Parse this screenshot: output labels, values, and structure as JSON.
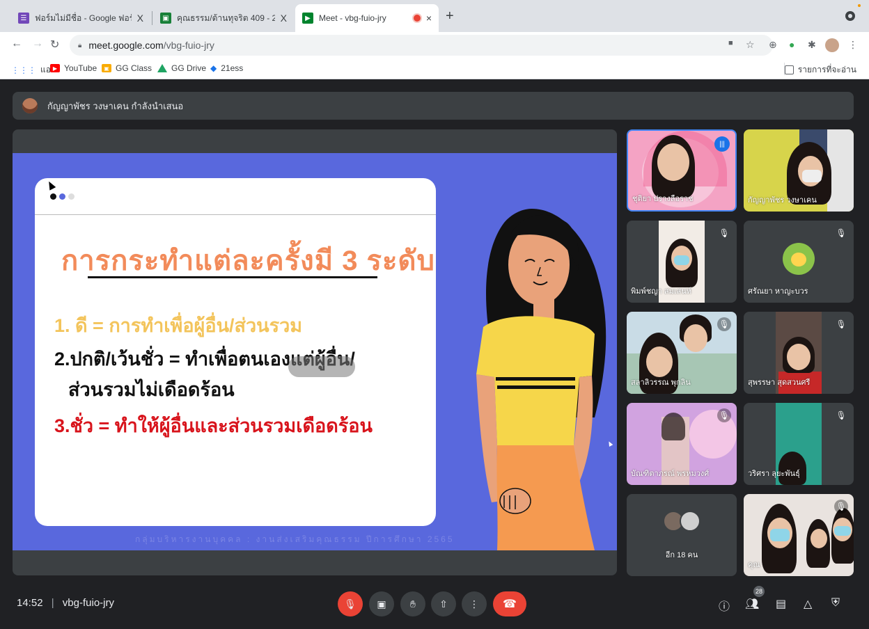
{
  "browser": {
    "tabs": [
      {
        "title": "ฟอร์มไม่มีชื่อ - Google ฟอร์ม",
        "close": "X",
        "favicon_color": "#7248b9"
      },
      {
        "title": "คุณธรรม/ต้านทุจริต 409 - 2564 ม",
        "close": "X",
        "favicon_color": "#188038"
      },
      {
        "title": "Meet - vbg-fuio-jry",
        "close": "×",
        "favicon_color": "#00832d",
        "recording_color": "#ea4335"
      }
    ],
    "new_tab": "+",
    "url_host": "meet.google.com",
    "url_path": "/vbg-fuio-jry",
    "bookmarks": [
      {
        "label": "แอป",
        "color": "#4285f4"
      },
      {
        "label": "YouTube",
        "color": "#ff0000"
      },
      {
        "label": "GG Class",
        "color": "#f9ab00"
      },
      {
        "label": "GG Drive",
        "color": "#1fa463"
      },
      {
        "label": "21ess",
        "color": "#1a73e8"
      }
    ],
    "reading_list": "รายการที่จะอ่าน"
  },
  "meet": {
    "presenting_text": "กัญญาพัชร วงษาเคน กำลังนำเสนอ",
    "slide": {
      "title": "การกระทำแต่ละครั้งมี 3 ระดับ",
      "line1": "1. ดี = การทำเพื่อผู้อื่น/ส่วนรวม",
      "line2": "2.ปกติ/เว้นชั่ว = ทำเพื่อตนเองแต่ผู้อื่น/",
      "line3": "ส่วนรวมไม่เดือดร้อน",
      "line4": "3.ชั่ว = ทำให้ผู้อื่นและส่วนรวมเดือดร้อน",
      "footer": "กลุ่มบริหารงานบุคคล : งานส่งเสริมคุณธรรม ปีการศึกษา 2565"
    },
    "participants": [
      {
        "name": "ชุติยา ปรางลือราช",
        "status": "speaking"
      },
      {
        "name": "กัญญาพัชร วงษาเคน",
        "status": "none"
      },
      {
        "name": "พิมพ์ชญา สมเสน่ห์",
        "status": "muted"
      },
      {
        "name": "ศรัณยา หาญะบวร",
        "status": "muted"
      },
      {
        "name": "สลาลิวรรณ พุกลิน",
        "status": "muted"
      },
      {
        "name": "สุพรรษา สุดสวนศรี",
        "status": "muted"
      },
      {
        "name": "บัณฑิตาภรณ์ พรหมวงศ์",
        "status": "muted"
      },
      {
        "name": "วริศรา ลุยะพันธุ์",
        "status": "muted"
      },
      {
        "name": "อีก 18 คน",
        "status": "none"
      },
      {
        "name": "คุณ",
        "status": "muted"
      }
    ],
    "time": "14:52",
    "meeting_code": "vbg-fuio-jry",
    "people_count": "28"
  }
}
